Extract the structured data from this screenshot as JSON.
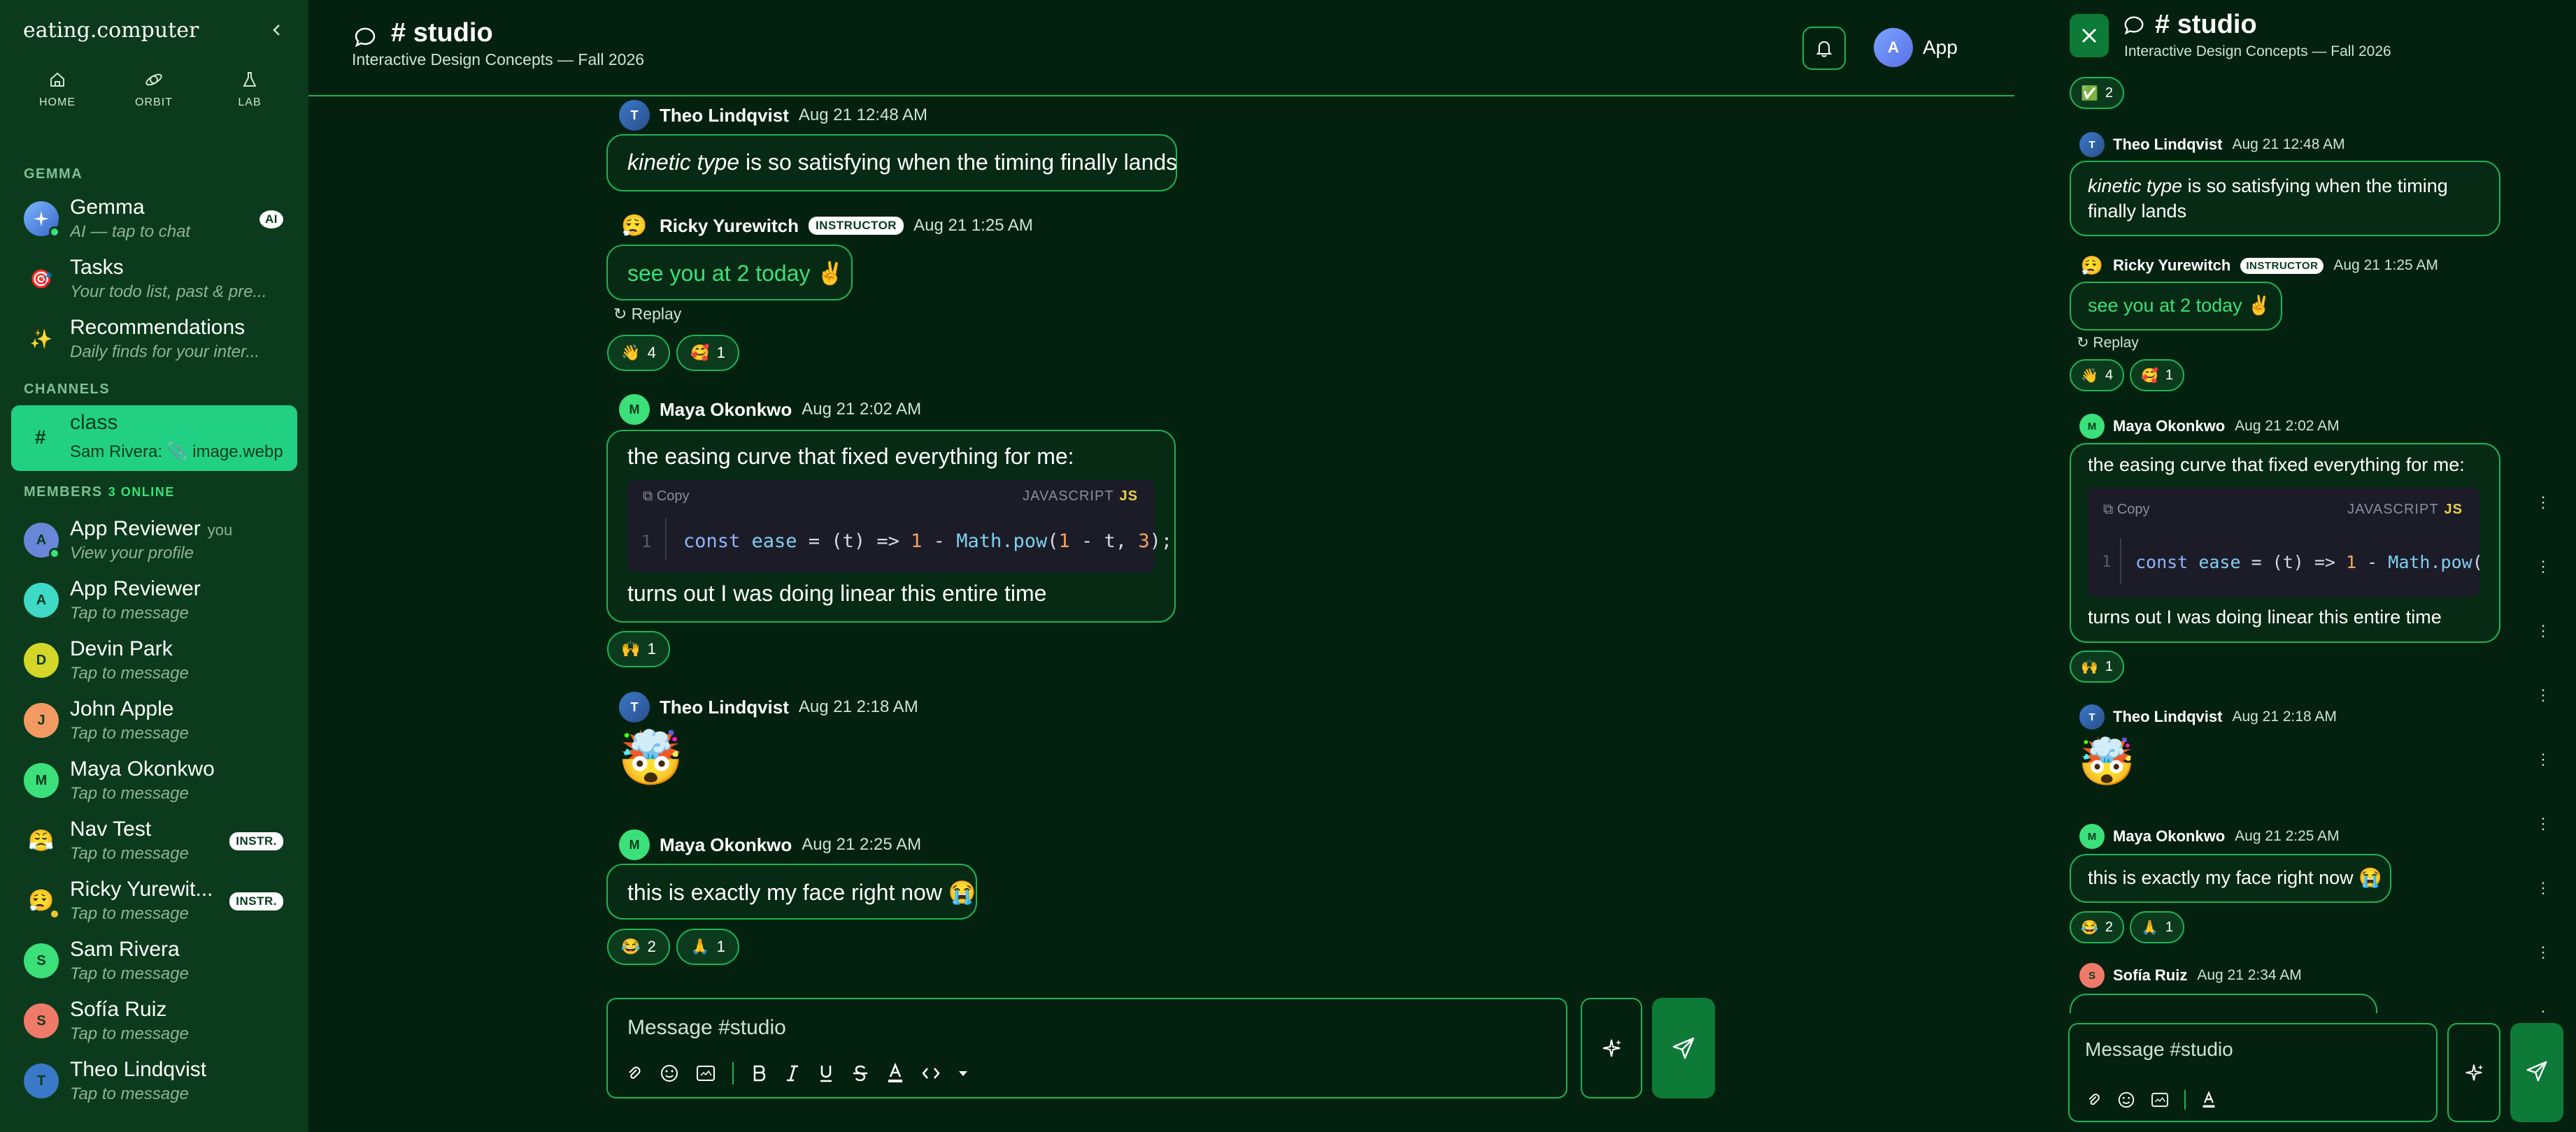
{
  "sidebar": {
    "brand": "eating.computer",
    "nav": [
      {
        "label": "HOME",
        "icon": "home-icon"
      },
      {
        "label": "ORBIT",
        "icon": "orbit-icon"
      },
      {
        "label": "LAB",
        "icon": "flask-icon"
      }
    ],
    "sections": {
      "gemma": "GEMMA",
      "channels": "CHANNELS",
      "members": "MEMBERS",
      "online": "3 ONLINE"
    },
    "gemma_items": [
      {
        "name": "Gemma",
        "subtitle": "AI — tap to chat",
        "tag": "AI"
      },
      {
        "name": "Tasks",
        "subtitle": "Your todo list, past & pre..."
      },
      {
        "name": "Recommendations",
        "subtitle": "Daily finds for your inter..."
      }
    ],
    "channel": {
      "hash": "#",
      "name": "class",
      "preview": "Sam Rivera: 📎 image.webp"
    },
    "members": [
      {
        "name": "App Reviewer",
        "you": "you",
        "subtitle": "View your profile",
        "initial": "A",
        "color": "#6a86d8"
      },
      {
        "name": "App Reviewer",
        "subtitle": "Tap to message",
        "initial": "A",
        "color": "#3fd9c8"
      },
      {
        "name": "Devin Park",
        "subtitle": "Tap to message",
        "initial": "D",
        "color": "#d4d62a"
      },
      {
        "name": "John Apple",
        "subtitle": "Tap to message",
        "initial": "J",
        "color": "#f39a62"
      },
      {
        "name": "Maya Okonkwo",
        "subtitle": "Tap to message",
        "initial": "M",
        "color": "#3be07a"
      },
      {
        "name": "Nav Test",
        "subtitle": "Tap to message",
        "initial": "😤",
        "tag": "INSTR."
      },
      {
        "name": "Ricky Yurewit...",
        "subtitle": "Tap to message",
        "initial": "😮‍💨",
        "tag": "INSTR."
      },
      {
        "name": "Sam Rivera",
        "subtitle": "Tap to message",
        "initial": "S",
        "color": "#3be07a"
      },
      {
        "name": "Sofía Ruiz",
        "subtitle": "Tap to message",
        "initial": "S",
        "color": "#f07a6a"
      },
      {
        "name": "Theo Lindqvist",
        "subtitle": "Tap to message",
        "initial": "T",
        "color": "#3a78c8"
      }
    ]
  },
  "header": {
    "title": "# studio",
    "subtitle": "Interactive Design Concepts — Fall 2026",
    "user_initial": "A",
    "user_label": "App"
  },
  "messages": {
    "m1": {
      "author": "Theo Lindqvist",
      "initial": "T",
      "time": "Aug 21 12:48 AM",
      "text_italic": "kinetic type",
      "text": " is so satisfying when the timing finally lands"
    },
    "m2": {
      "author": "Ricky Yurewitch",
      "badge": "INSTRUCTOR",
      "time": "Aug 21 1:25 AM",
      "text": "see you at 2 today ✌️",
      "replay": "↻ Replay",
      "reactions": [
        {
          "emoji": "👋",
          "count": "4"
        },
        {
          "emoji": "🥰",
          "count": "1"
        }
      ]
    },
    "m3": {
      "author": "Maya Okonkwo",
      "initial": "M",
      "time": "Aug 21 2:02 AM",
      "text1": "the easing curve that fixed everything for me:",
      "copy": "Copy",
      "lang": "JAVASCRIPT",
      "lang_tag": "JS",
      "line": "1",
      "code_kw1": "const",
      "code_var": " ease ",
      "code_eq": "= (t) => ",
      "code_n1": "1",
      "code_mid": " - ",
      "code_math": "Math.pow",
      "code_open": "(",
      "code_n2": "1",
      "code_t": " - t, ",
      "code_n3": "3",
      "code_end": ");",
      "text2": "turns out I was doing linear this entire time",
      "reactions": [
        {
          "emoji": "🙌",
          "count": "1"
        }
      ]
    },
    "m4": {
      "author": "Theo Lindqvist",
      "initial": "T",
      "time": "Aug 21 2:18 AM",
      "emoji": "🤯"
    },
    "m5": {
      "author": "Maya Okonkwo",
      "initial": "M",
      "time": "Aug 21 2:25 AM",
      "text": "this is exactly my face right now 😭",
      "reactions": [
        {
          "emoji": "😂",
          "count": "2"
        },
        {
          "emoji": "🙏",
          "count": "1"
        }
      ]
    }
  },
  "composer": {
    "placeholder": "Message #studio"
  },
  "panel": {
    "title": "# studio",
    "subtitle": "Interactive Design Concepts — Fall 2026",
    "top_reaction": {
      "emoji": "✅",
      "count": "2"
    },
    "m6": {
      "author": "Sofía Ruiz",
      "initial": "S",
      "time": "Aug 21 2:34 AM"
    }
  },
  "colors": {
    "accent": "#1db357",
    "bg": "#04210f",
    "sidebar": "#0b3b1c",
    "active": "#22d083"
  }
}
